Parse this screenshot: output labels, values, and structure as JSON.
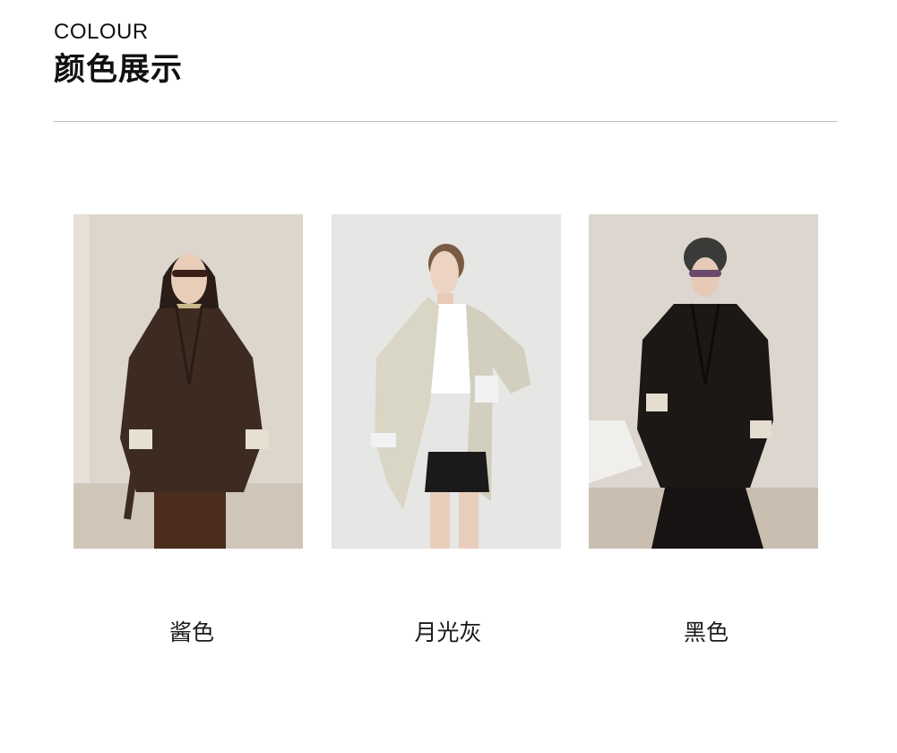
{
  "header": {
    "title_en": "COLOUR",
    "title_zh": "颜色展示"
  },
  "colours": [
    {
      "label": "酱色",
      "coat_color": "#3d2b22",
      "bg_color": "#ddd6cd"
    },
    {
      "label": "月光灰",
      "coat_color": "#d9d6c6",
      "bg_color": "#e6e6e4"
    },
    {
      "label": "黑色",
      "coat_color": "#1c1816",
      "bg_color": "#dcd6cf"
    }
  ]
}
